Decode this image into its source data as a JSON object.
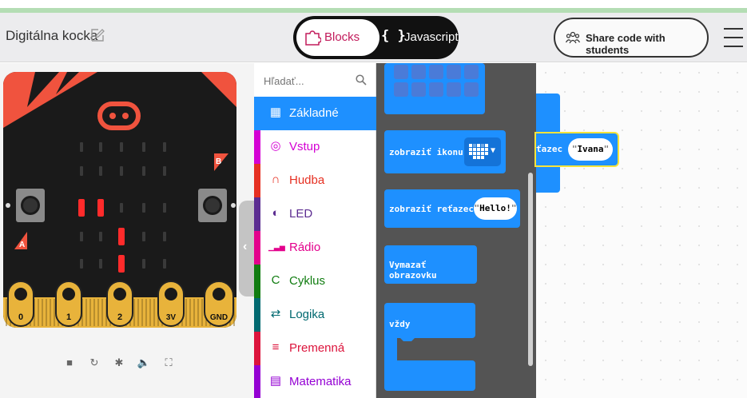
{
  "header": {
    "project_title": "Digitálna kocka",
    "mode_blocks_label": "Blocks",
    "mode_js_brace": "{ }",
    "mode_js_label": "Javascript",
    "share_label": "Share code with students"
  },
  "colors": {
    "header_bg": "#ececee",
    "blocks_accent": "#c21b5b",
    "microbit_board": "#1a1a1a",
    "microbit_red": "#f0533e",
    "led_on": "#ff2b2b",
    "pins_gold": "#e8b33b",
    "block_blue": "#1e90ff",
    "flyout_bg": "#545454"
  },
  "simulator": {
    "button_a_label": "A",
    "button_b_label": "B",
    "pins": [
      "0",
      "1",
      "2",
      "3V",
      "GND"
    ],
    "leds_on": [
      [
        2,
        0
      ],
      [
        2,
        1
      ],
      [
        3,
        2
      ],
      [
        4,
        2
      ],
      [
        5,
        2
      ]
    ],
    "toolbar": [
      {
        "name": "stop-icon",
        "glyph": "■"
      },
      {
        "name": "restart-icon",
        "glyph": "↻"
      },
      {
        "name": "debug-icon",
        "glyph": "✱"
      },
      {
        "name": "sound-icon",
        "glyph": "🔈"
      },
      {
        "name": "fullscreen-icon",
        "glyph": "⛶"
      }
    ]
  },
  "toolbox": {
    "search_placeholder": "Hľadať...",
    "categories": [
      {
        "label": "Základné",
        "icon": "grid-icon",
        "color": "#1e90ff",
        "selected": true
      },
      {
        "label": "Vstup",
        "icon": "target-icon",
        "color": "#d400d4"
      },
      {
        "label": "Hudba",
        "icon": "headphones-icon",
        "color": "#e63022"
      },
      {
        "label": "LED",
        "icon": "toggle-icon",
        "color": "#5c2d91"
      },
      {
        "label": "Rádio",
        "icon": "signal-bars-icon",
        "color": "#e3008c"
      },
      {
        "label": "Cyklus",
        "icon": "loop-icon",
        "color": "#107c10"
      },
      {
        "label": "Logika",
        "icon": "shuffle-icon",
        "color": "#006970"
      },
      {
        "label": "Premenná",
        "icon": "lines-icon",
        "color": "#dc143c"
      },
      {
        "label": "Matematika",
        "icon": "calculator-icon",
        "color": "#9400d3"
      }
    ]
  },
  "flyout": {
    "show_icon_label": "zobraziť ikonu",
    "show_string_label": "zobraziť reťazec",
    "show_string_value": "Hello!",
    "clear_screen_label": "Vymazať obrazovku",
    "forever_label": "vždy"
  },
  "canvas": {
    "block_label": "ťazec",
    "block_value": "Ivana"
  }
}
